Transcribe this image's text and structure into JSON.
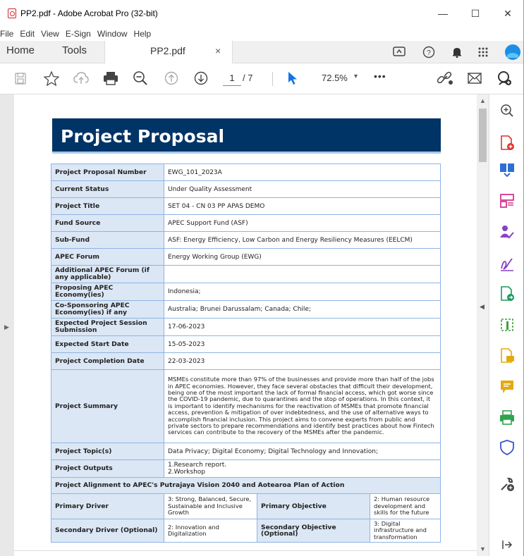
{
  "window": {
    "title": "PP2.pdf - Adobe Acrobat Pro (32-bit)",
    "min": "—",
    "max": "☐",
    "close": "✕"
  },
  "menu": [
    "File",
    "Edit",
    "View",
    "E-Sign",
    "Window",
    "Help"
  ],
  "tabs": {
    "home": "Home",
    "tools": "Tools",
    "doc": "PP2.pdf",
    "doc_close": "×"
  },
  "toolbar": {
    "page_current": "1",
    "page_total": "/ 7",
    "zoom": "72.5%",
    "zoom_caret": "▾",
    "more": "•••"
  },
  "document": {
    "heading": "Project Proposal",
    "rows": [
      {
        "label": "Project Proposal Number",
        "value": "EWG_101_2023A"
      },
      {
        "label": "Current Status",
        "value": "Under Quality Assessment"
      },
      {
        "label": "Project Title",
        "value": "SET 04 - CN 03 PP APAS DEMO"
      },
      {
        "label": "Fund Source",
        "value": "APEC Support Fund (ASF)"
      },
      {
        "label": "Sub-Fund",
        "value": "ASF: Energy Efficiency, Low Carbon and Energy Resiliency Measures (EELCM)"
      },
      {
        "label": "APEC Forum",
        "value": "Energy Working Group (EWG)"
      },
      {
        "label": "Additional APEC Forum (if any applicable)",
        "value": ""
      },
      {
        "label": "Proposing APEC Economy(ies)",
        "value": "Indonesia;"
      },
      {
        "label": "Co-Sponsoring APEC Economy(ies) if any",
        "value": "Australia;   Brunei Darussalam;   Canada;   Chile;"
      },
      {
        "label": "Expected Project Session Submission",
        "value": "17-06-2023"
      },
      {
        "label": "Expected Start Date",
        "value": "15-05-2023"
      },
      {
        "label": "Project Completion Date",
        "value": "22-03-2023"
      },
      {
        "label": "Project Summary",
        "value": "MSMEs constitute more than 97% of the businesses and provide more than half of the jobs in APEC economies. However, they face several obstacles that difficult their development, being one of the most important the lack of formal financial access, which got worse since the COVID-19 pandemic, due to quarantines and the stop of operations. In this context, it is important to identify mechanisms for the reactivation of MSMEs that promote financial access, prevention & mitigation of over indebtedness, and the use of alternative ways to accomplish financial inclusion. This project aims to convene experts from public and private sectors to prepare recommendations and identify best practices about how Fintech services can contribute to the recovery of the MSMEs after the pandemic."
      },
      {
        "label": "Project Topic(s)",
        "value": "Data Privacy;   Digital Economy;   Digital Technology and Innovation;"
      }
    ],
    "outputs_label": "Project Outputs",
    "outputs": [
      "1.Research report.",
      "2.Workshop"
    ],
    "alignment_heading": "Project Alignment to APEC's Putrajaya Vision 2040 and Aotearoa Plan of Action",
    "primary_driver_label": "Primary Driver",
    "primary_driver_value": "3: Strong, Balanced, Secure, Sustainable and Inclusive Growth",
    "primary_objective_label": "Primary Objective",
    "primary_objective_value": "2: Human resource development and skills for the future",
    "secondary_driver_label": "Secondary Driver (Optional)",
    "secondary_driver_value": "2: Innovation and Digitalization",
    "secondary_objective_label": "Secondary Objective (Optional)",
    "secondary_objective_value": "3: Digital infrastructure and transformation"
  },
  "colors": {
    "banner": "#003366",
    "label_bg": "#dbe7f5",
    "border": "#8eb4e3",
    "accent_red": "#d0262c"
  }
}
